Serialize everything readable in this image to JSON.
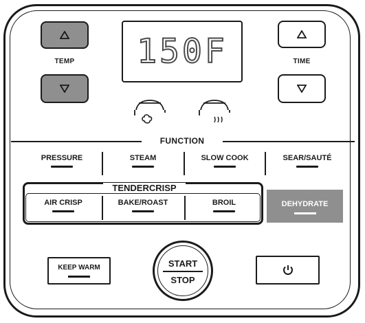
{
  "display": {
    "value": "150F"
  },
  "temp": {
    "label": "TEMP",
    "up_icon": "triangle-up-icon",
    "down_icon": "triangle-down-icon"
  },
  "time": {
    "label": "TIME",
    "up_icon": "triangle-up-icon",
    "down_icon": "triangle-down-icon"
  },
  "lid_icons": [
    "pressure-lid-icon",
    "crisping-lid-icon"
  ],
  "function": {
    "label": "FUNCTION",
    "items": [
      {
        "label": "PRESSURE"
      },
      {
        "label": "STEAM"
      },
      {
        "label": "SLOW COOK"
      },
      {
        "label": "SEAR/SAUTÉ"
      }
    ]
  },
  "tendercrisp": {
    "label": "TENDERCRISP",
    "items": [
      {
        "label": "AIR CRISP"
      },
      {
        "label": "BAKE/ROAST"
      },
      {
        "label": "BROIL"
      }
    ]
  },
  "dehydrate": {
    "label": "DEHYDRATE",
    "selected": true
  },
  "keep_warm": {
    "label": "KEEP WARM"
  },
  "start_stop": {
    "top": "START",
    "bottom": "STOP"
  },
  "power": {
    "icon": "power-icon"
  },
  "colors": {
    "selected_bg": "#8f8f8f",
    "outline": "#1a1a1a"
  }
}
